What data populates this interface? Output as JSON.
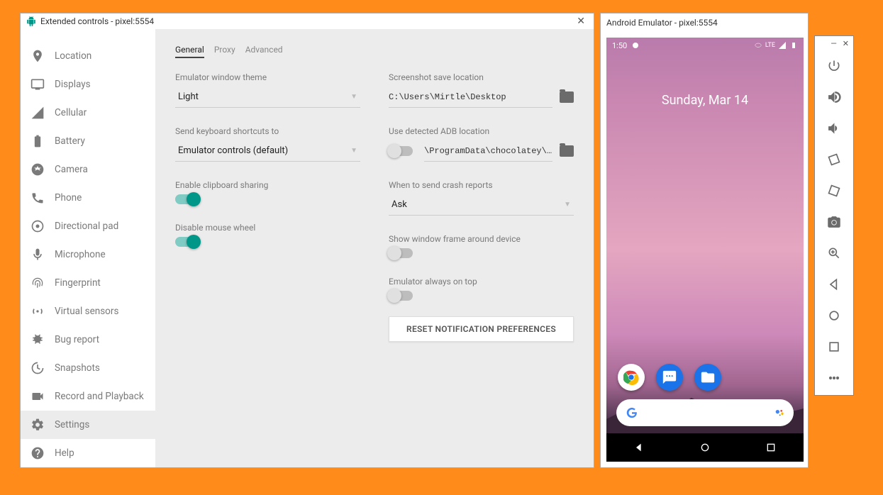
{
  "ext_controls": {
    "title": "Extended controls - pixel:5554",
    "sidebar": {
      "items": [
        {
          "label": "Location"
        },
        {
          "label": "Displays"
        },
        {
          "label": "Cellular"
        },
        {
          "label": "Battery"
        },
        {
          "label": "Camera"
        },
        {
          "label": "Phone"
        },
        {
          "label": "Directional pad"
        },
        {
          "label": "Microphone"
        },
        {
          "label": "Fingerprint"
        },
        {
          "label": "Virtual sensors"
        },
        {
          "label": "Bug report"
        },
        {
          "label": "Snapshots"
        },
        {
          "label": "Record and Playback"
        },
        {
          "label": "Settings"
        },
        {
          "label": "Help"
        }
      ]
    },
    "tabs": {
      "general": "General",
      "proxy": "Proxy",
      "advanced": "Advanced"
    },
    "left_col": {
      "theme_label": "Emulator window theme",
      "theme_value": "Light",
      "shortcuts_label": "Send keyboard shortcuts to",
      "shortcuts_value": "Emulator controls (default)",
      "clipboard_label": "Enable clipboard sharing",
      "mouse_label": "Disable mouse wheel"
    },
    "right_col": {
      "screenshot_label": "Screenshot save location",
      "screenshot_value": "C:\\Users\\Mirtle\\Desktop",
      "adb_label": "Use detected ADB location",
      "adb_value": "\\ProgramData\\chocolatey\\…",
      "crash_label": "When to send crash reports",
      "crash_value": "Ask",
      "frame_label": "Show window frame around device",
      "ontop_label": "Emulator always on top",
      "reset_btn": "RESET NOTIFICATION PREFERENCES"
    }
  },
  "emulator": {
    "title": "Android Emulator - pixel:5554",
    "status": {
      "time": "1:50",
      "signal": "LTE"
    },
    "date": "Sunday, Mar 14"
  }
}
